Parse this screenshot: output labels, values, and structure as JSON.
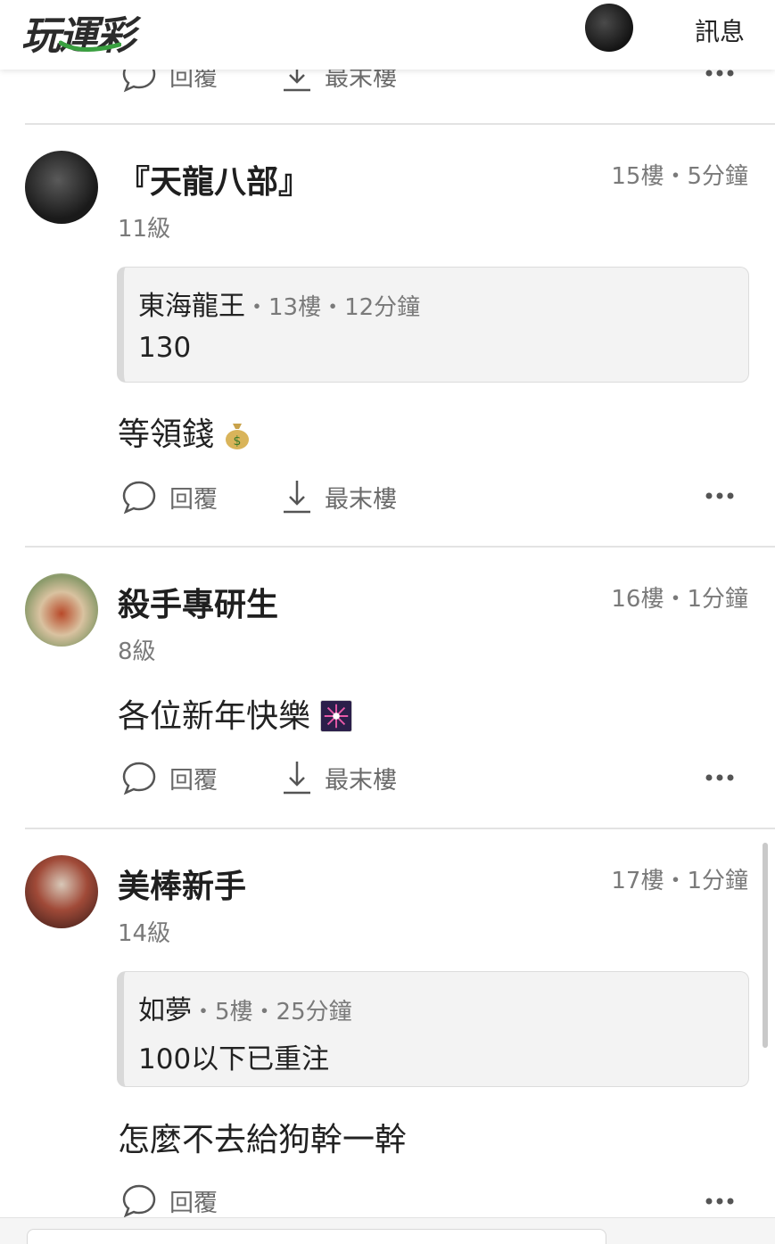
{
  "header": {
    "logo": "玩運彩",
    "messages_label": "訊息"
  },
  "actions": {
    "reply": "回覆",
    "last_floor": "最末樓"
  },
  "posts": [
    {
      "username": "『天龍八部』",
      "level": "11級",
      "floor_time": "15樓・5分鐘",
      "quote": {
        "author": "東海龍王",
        "meta": "・13樓・12分鐘",
        "body": "130"
      },
      "content": "等領錢"
    },
    {
      "username": "殺手專研生",
      "level": "8級",
      "floor_time": "16樓・1分鐘",
      "content": "各位新年快樂"
    },
    {
      "username": "美棒新手",
      "level": "14級",
      "floor_time": "17樓・1分鐘",
      "quote": {
        "author": "如夢",
        "meta": "・5樓・25分鐘",
        "body": "100以下已重注"
      },
      "content": "怎麼不去給狗幹一幹"
    }
  ],
  "colors": {
    "accent_green": "#3aa040",
    "text": "#222222",
    "muted": "#7a7a7a"
  }
}
